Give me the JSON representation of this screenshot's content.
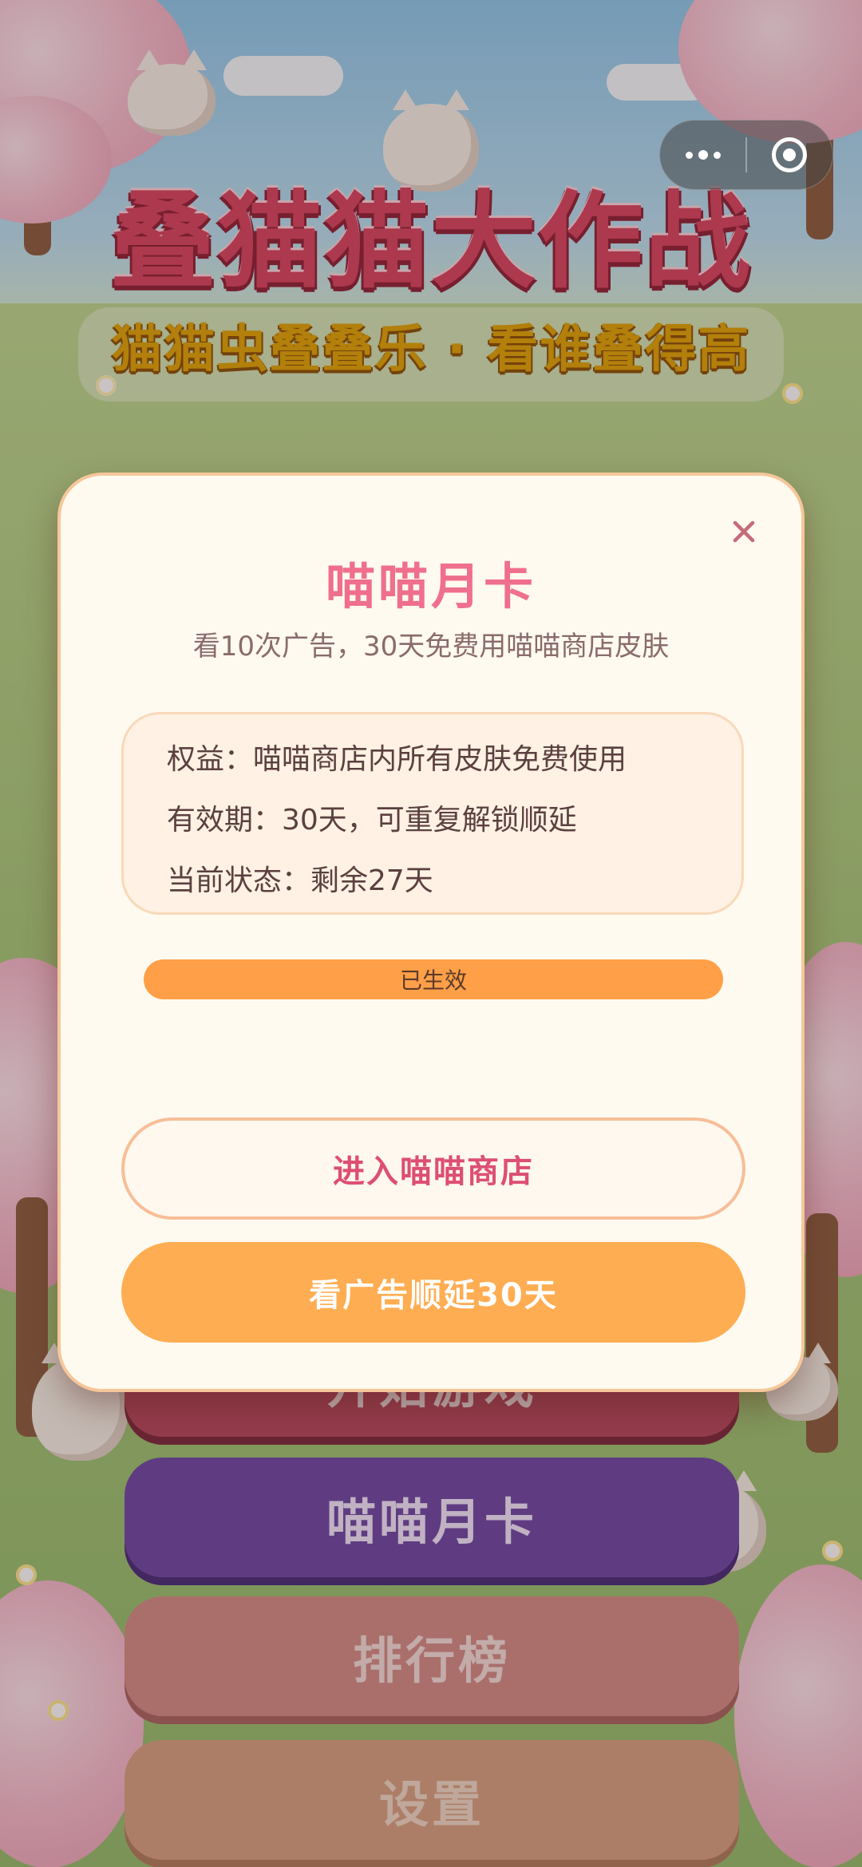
{
  "game": {
    "title": "叠猫猫大作战",
    "subtitle": "猫猫虫叠叠乐 · 看谁叠得高"
  },
  "capsule": {
    "more_icon": "more-dots-icon",
    "close_icon": "target-circle-icon"
  },
  "menu": {
    "start_label": "开始游戏",
    "monthly_card_label": "喵喵月卡",
    "leaderboard_label": "排行榜",
    "settings_label": "设置"
  },
  "modal": {
    "title": "喵喵月卡",
    "description": "看10次广告，30天免费用喵喵商店皮肤",
    "benefits": [
      "权益：喵喵商店内所有皮肤免费使用",
      "有效期：30天，可重复解锁顺延",
      "当前状态：剩余27天"
    ],
    "status_label": "已生效",
    "status_progress": 1.0,
    "enter_shop_label": "进入喵喵商店",
    "watch_ad_label": "看广告顺延30天",
    "close_icon": "close-x-icon"
  },
  "colors": {
    "accent_pink": "#ef6f8c",
    "accent_orange": "#ffad52",
    "modal_bg": "#fffaf0"
  }
}
